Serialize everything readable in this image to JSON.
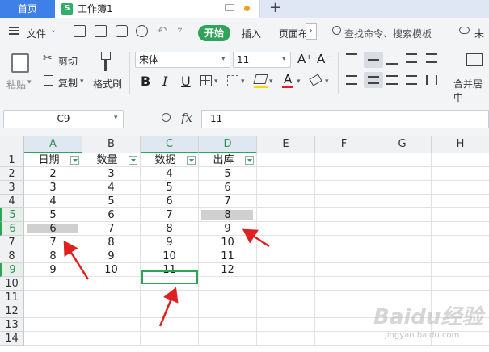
{
  "tabs": {
    "home_label": "首页",
    "doc_icon_letter": "S",
    "doc_title": "工作簿1",
    "new_tab_symbol": "+"
  },
  "menu": {
    "file_label": "文件",
    "start_label": "开始",
    "insert_label": "插入",
    "layout_label": "页面布",
    "search_placeholder": "查找命令、搜索模板",
    "user_label": "未"
  },
  "ribbon": {
    "paste_label": "粘贴",
    "cut_label": "剪切",
    "copy_label": "复制",
    "format_painter_label": "格式刷",
    "font_name": "宋体",
    "font_size": "11",
    "bold": "B",
    "italic": "I",
    "underline": "U",
    "font_color_letter": "A",
    "grow_font": "A⁺",
    "shrink_font": "A⁻",
    "merge_label": "合并居中"
  },
  "formula_bar": {
    "cell_ref": "C9",
    "fx": "fx",
    "value": "11"
  },
  "grid": {
    "columns": [
      "A",
      "B",
      "C",
      "D",
      "E",
      "F",
      "G",
      "H"
    ],
    "rows": [
      "1",
      "2",
      "3",
      "4",
      "5",
      "6",
      "7",
      "8",
      "9",
      "10",
      "11",
      "12",
      "13",
      "14"
    ],
    "header_row": [
      "日期",
      "数量",
      "数据",
      "出库"
    ],
    "data": [
      [
        "2",
        "3",
        "4",
        "5"
      ],
      [
        "3",
        "4",
        "5",
        "6"
      ],
      [
        "4",
        "5",
        "6",
        "7"
      ],
      [
        "5",
        "6",
        "7",
        "8"
      ],
      [
        "6",
        "7",
        "8",
        "9"
      ],
      [
        "7",
        "8",
        "9",
        "10"
      ],
      [
        "8",
        "9",
        "10",
        "11"
      ],
      [
        "9",
        "10",
        "11",
        "12"
      ]
    ],
    "active_cell": "C9"
  },
  "watermark": {
    "text": "Baidu经验",
    "url": "jingyan.baidu.com"
  },
  "colors": {
    "accent": "#2ea35a",
    "home_tab": "#3f7fe8",
    "arrow": "#e02020",
    "highlight": "#d0d0d0"
  }
}
